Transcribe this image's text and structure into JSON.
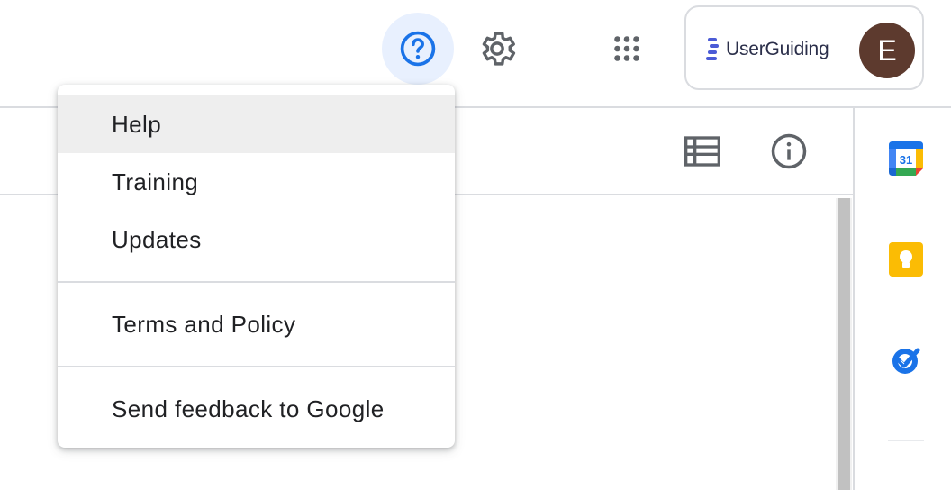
{
  "header": {
    "help_icon": "help-circle-icon",
    "settings_icon": "gear-icon",
    "apps_icon": "apps-grid-icon",
    "account": {
      "brand_text": "UserGuiding",
      "avatar_initial": "E"
    }
  },
  "toolbar": {
    "list_view_icon": "list-view-icon",
    "info_icon": "info-icon"
  },
  "side_panel": {
    "apps": [
      {
        "name": "Google Calendar",
        "icon": "calendar-icon",
        "text": "31"
      },
      {
        "name": "Google Keep",
        "icon": "keep-icon"
      },
      {
        "name": "Google Tasks",
        "icon": "tasks-icon"
      }
    ]
  },
  "help_menu": {
    "items": [
      {
        "label": "Help",
        "highlighted": true
      },
      {
        "label": "Training"
      },
      {
        "label": "Updates"
      },
      {
        "label": "Terms and Policy"
      },
      {
        "label": "Send feedback to Google"
      }
    ]
  },
  "colors": {
    "accent_blue": "#1a73e8",
    "help_bg": "#e8f0fe",
    "avatar_bg": "#5d3a2e",
    "keep_yellow": "#fbbc04"
  }
}
